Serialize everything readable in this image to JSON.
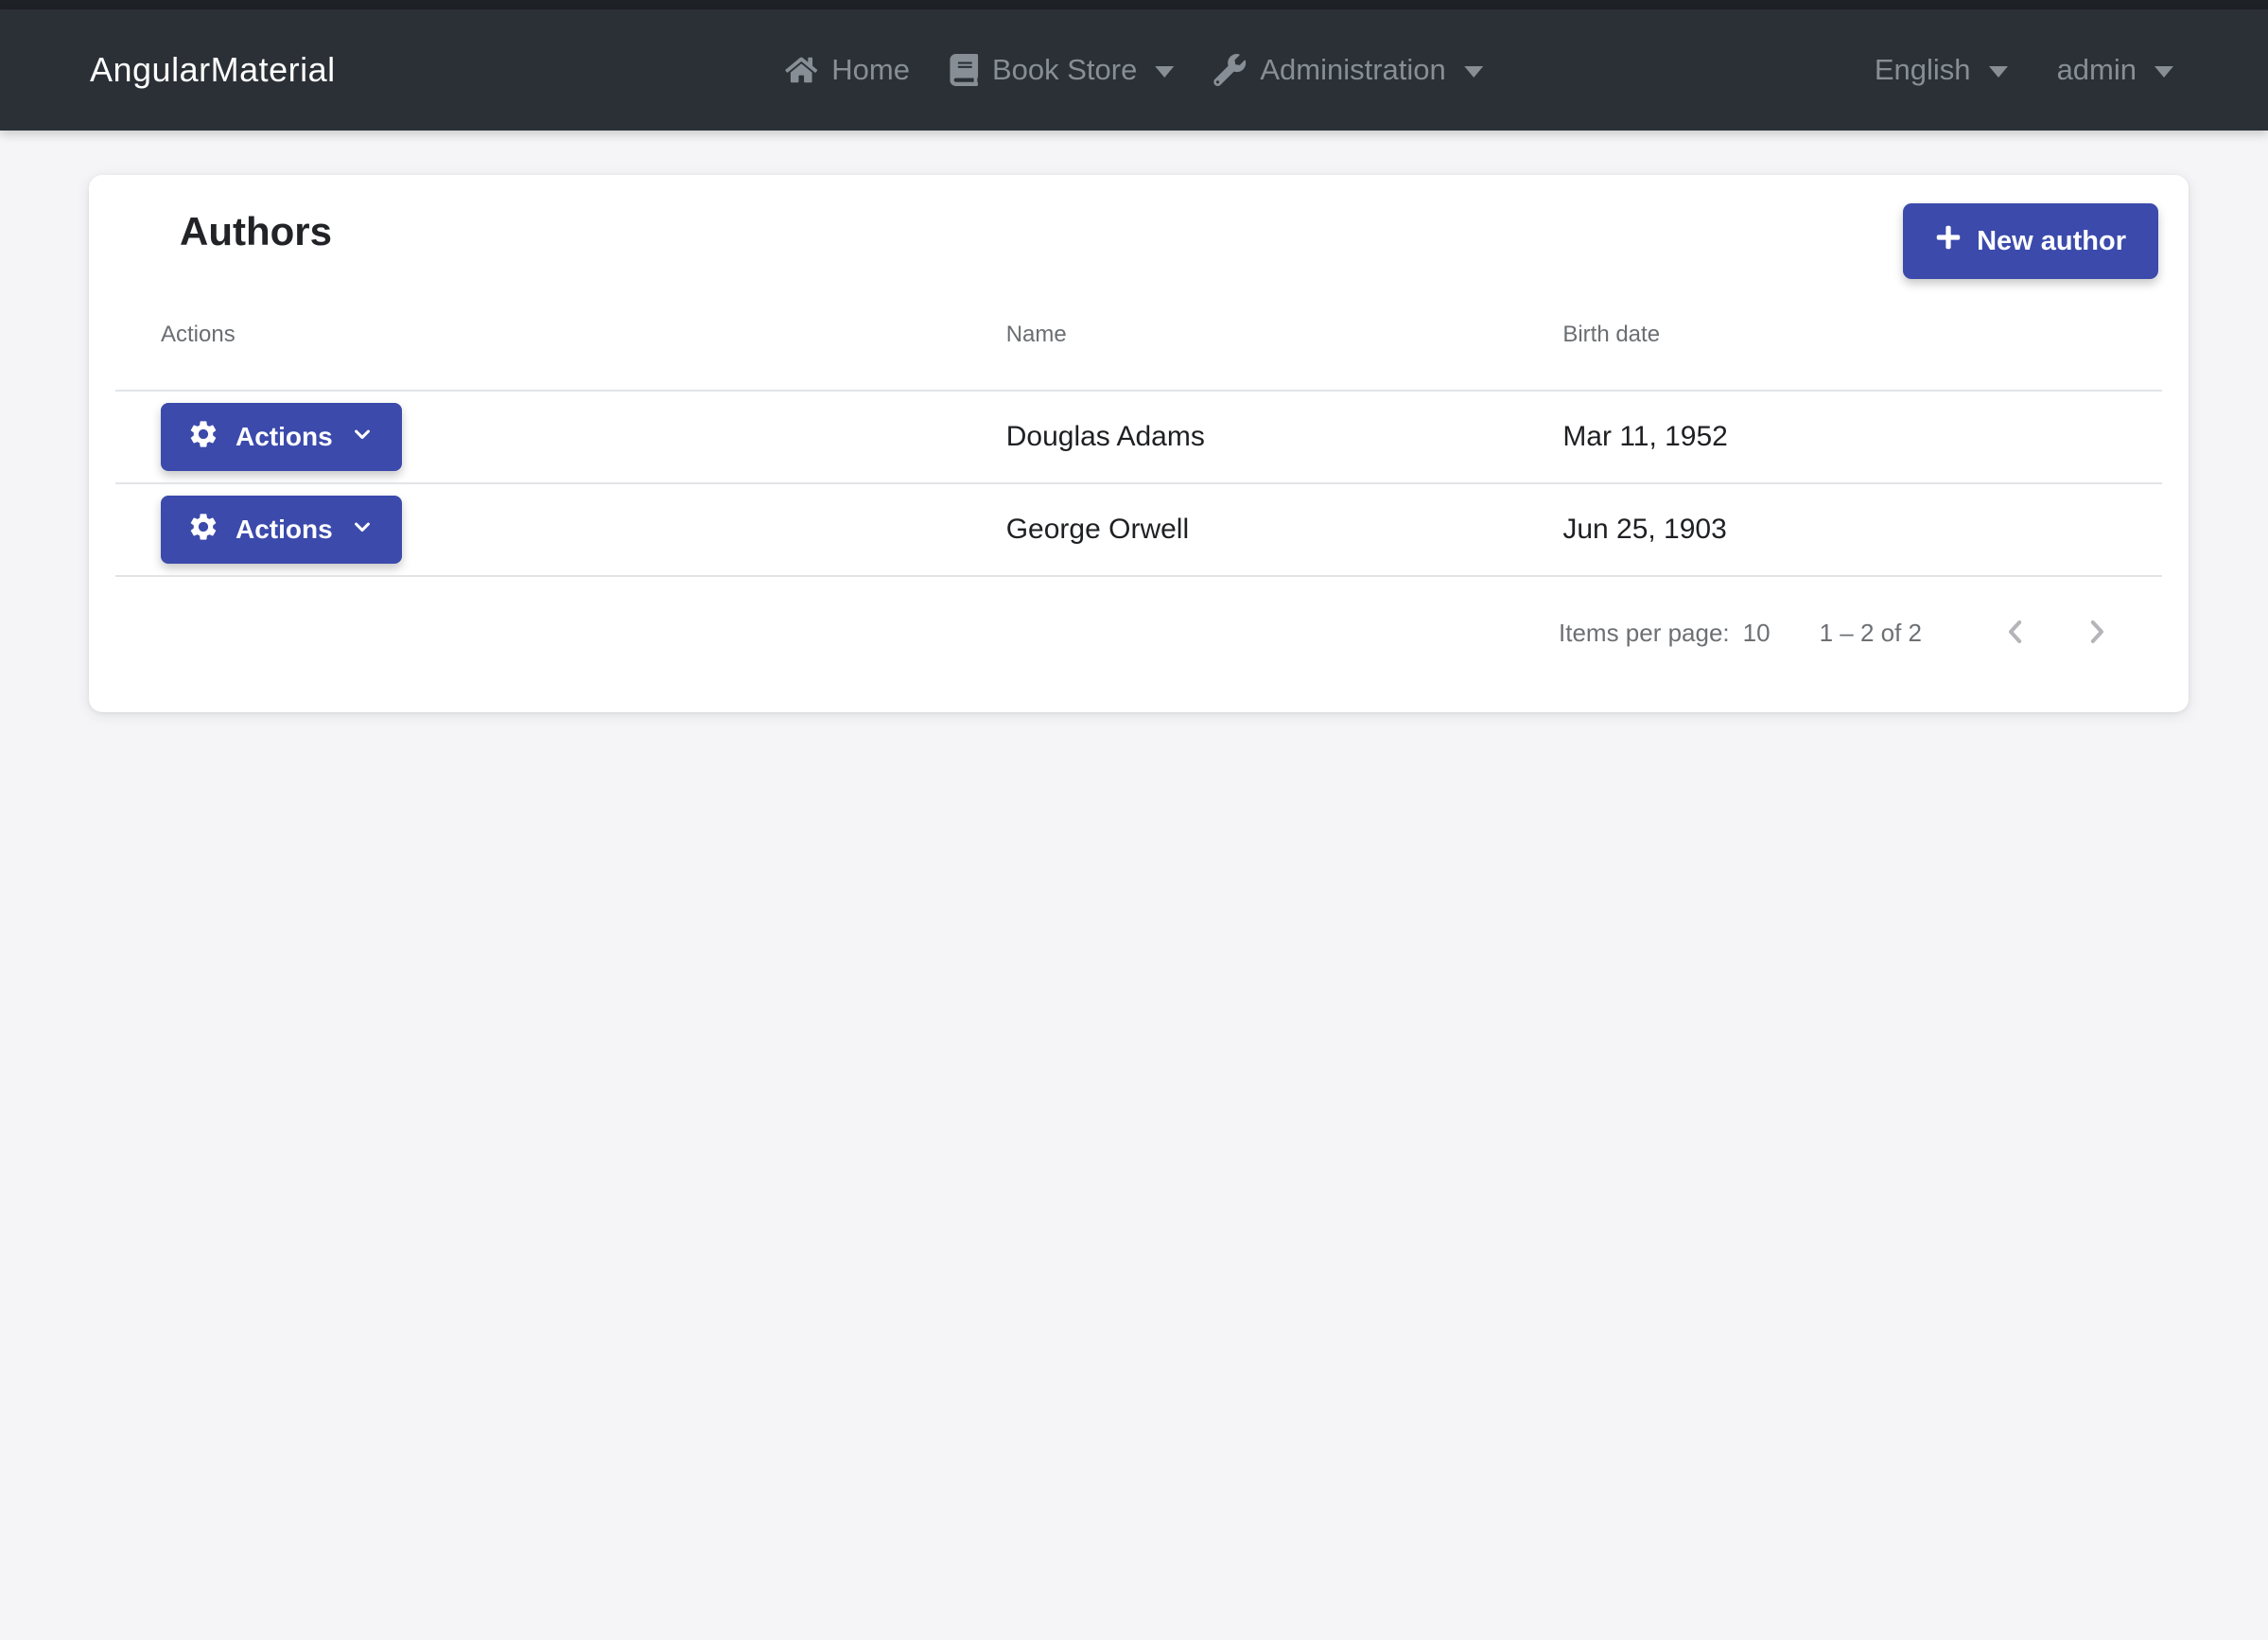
{
  "navbar": {
    "brand": "AngularMaterial",
    "items": [
      {
        "label": "Home",
        "icon": "home-icon",
        "has_caret": false
      },
      {
        "label": "Book Store",
        "icon": "book-icon",
        "has_caret": true
      },
      {
        "label": "Administration",
        "icon": "wrench-icon",
        "has_caret": true
      }
    ],
    "right": [
      {
        "label": "English",
        "has_caret": true
      },
      {
        "label": "admin",
        "has_caret": true
      }
    ]
  },
  "card": {
    "title": "Authors",
    "new_author_button_label": "New author",
    "table": {
      "columns": [
        "Actions",
        "Name",
        "Birth date"
      ],
      "rows": [
        {
          "actions_label": "Actions",
          "name": "Douglas Adams",
          "birth_date": "Mar 11, 1952"
        },
        {
          "actions_label": "Actions",
          "name": "George Orwell",
          "birth_date": "Jun 25, 1903"
        }
      ]
    },
    "paginator": {
      "items_per_page_label": "Items per page:",
      "page_size": "10",
      "range_label": "1 – 2 of 2"
    }
  },
  "colors": {
    "accent": "#3b4aab",
    "navbar_background": "#2b3036",
    "navbar_text": "#878e96",
    "page_background": "#f5f5f7",
    "divider": "#e2e4e7",
    "paginator_chevron": "#b3b5b9"
  }
}
